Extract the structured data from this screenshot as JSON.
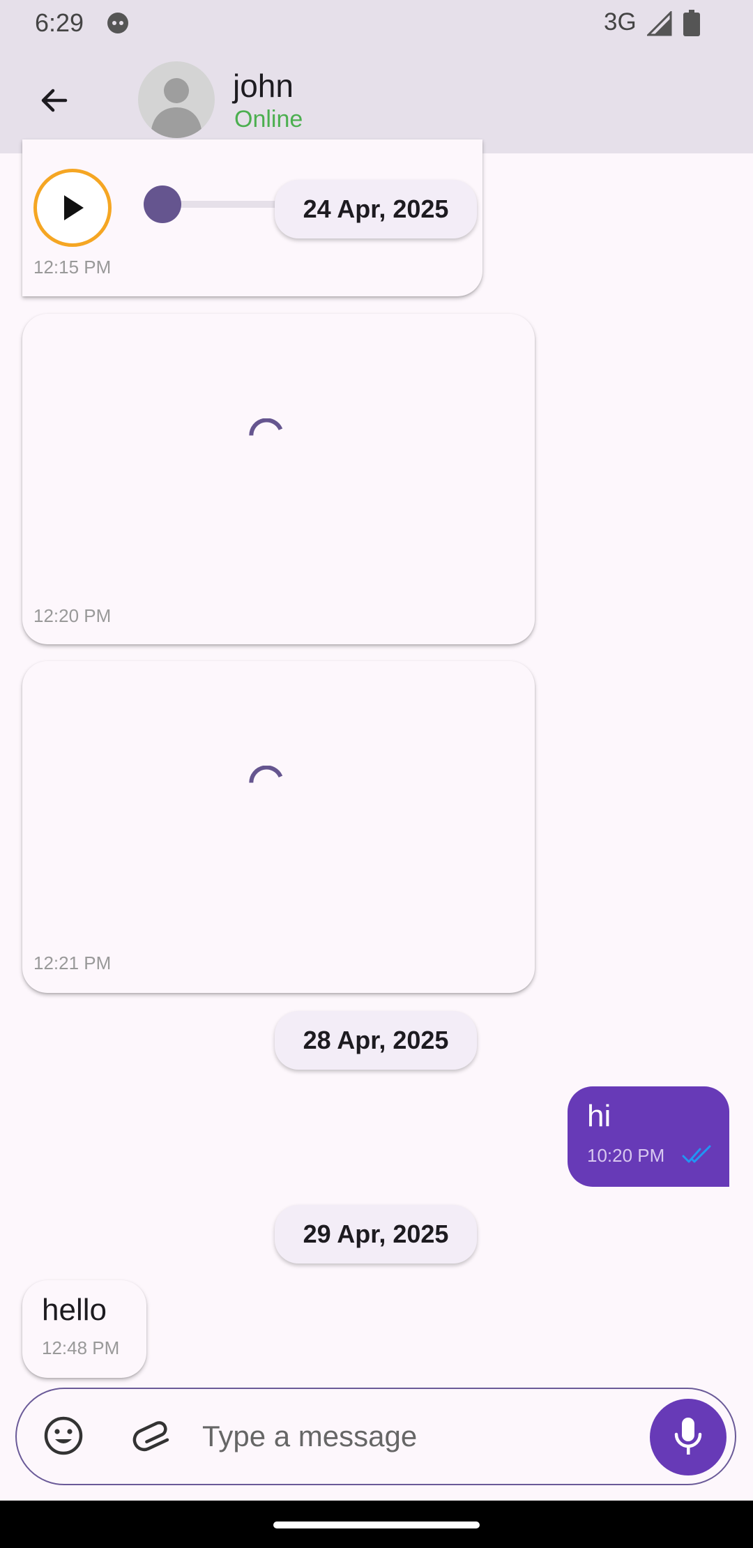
{
  "status_bar": {
    "time": "6:29",
    "network": "3G"
  },
  "header": {
    "contact_name": "john",
    "contact_status": "Online"
  },
  "messages": {
    "audio": {
      "time": "12:15 PM"
    },
    "image_1": {
      "time": "12:20 PM"
    },
    "image_2": {
      "time": "12:21 PM"
    },
    "sent": {
      "text": "hi",
      "time": "10:20 PM"
    },
    "received": {
      "text": "hello",
      "time": "12:48 PM"
    }
  },
  "date_chips": [
    "24 Apr, 2025",
    "28 Apr, 2025",
    "29 Apr, 2025"
  ],
  "input": {
    "placeholder": "Type a message"
  },
  "colors": {
    "accent": "#673ab7",
    "online": "#4caf50",
    "read_ticks": "#2196f3",
    "play_ring": "#f5a623"
  },
  "icons": [
    "back-arrow-icon",
    "avatar-icon",
    "play-icon",
    "spinner-icon",
    "double-check-icon",
    "emoji-icon",
    "paperclip-icon",
    "mic-icon",
    "signal-icon",
    "battery-icon"
  ]
}
